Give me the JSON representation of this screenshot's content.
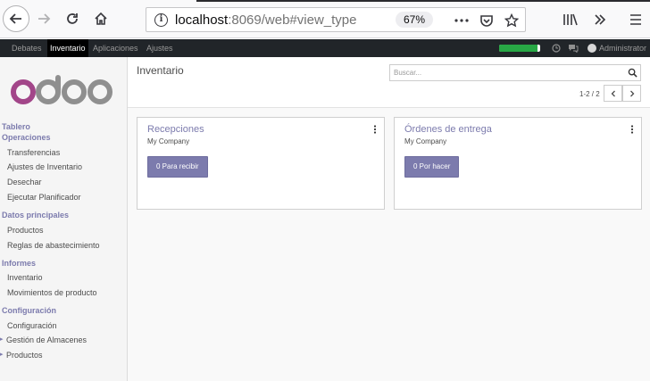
{
  "browser": {
    "url_host": "localhost",
    "url_rest": ":8069/web#view_type",
    "zoom": "67%"
  },
  "topnav": {
    "apps": [
      {
        "label": "Debates",
        "active": false
      },
      {
        "label": "Inventario",
        "active": true
      },
      {
        "label": "Aplicaciones",
        "active": false
      },
      {
        "label": "Ajustes",
        "active": false
      }
    ],
    "progress_fraction": 0.94,
    "progress_color": "#28a745",
    "user": "Administrator"
  },
  "sidebar": {
    "logo_text": "odoo",
    "sections": [
      {
        "label": "Tablero"
      },
      {
        "label": "Operaciones",
        "items": [
          "Transferencias",
          "Ajustes de Inventario",
          "Desechar",
          "Ejecutar Planificador"
        ]
      },
      {
        "label": "Datos principales",
        "items": [
          "Productos",
          "Reglas de abastecimiento"
        ]
      },
      {
        "label": "Informes",
        "items": [
          "Inventario",
          "Movimientos de producto"
        ]
      },
      {
        "label": "Configuración",
        "items": [
          "Configuración",
          "Gestión de Almacenes",
          "Productos"
        ]
      }
    ]
  },
  "control_panel": {
    "breadcrumb": "Inventario",
    "search_placeholder": "Buscar...",
    "pager": "1-2 / 2"
  },
  "cards": [
    {
      "title": "Recepciones",
      "company": "My Company",
      "button": "0 Para recibir"
    },
    {
      "title": "Órdenes de entrega",
      "company": "My Company",
      "button": "0 Por hacer"
    }
  ],
  "colors": {
    "brand": "#7c7bad",
    "nav_bg": "#212529",
    "logo_purple": "#a24689",
    "logo_gray": "#8f8f8f"
  }
}
